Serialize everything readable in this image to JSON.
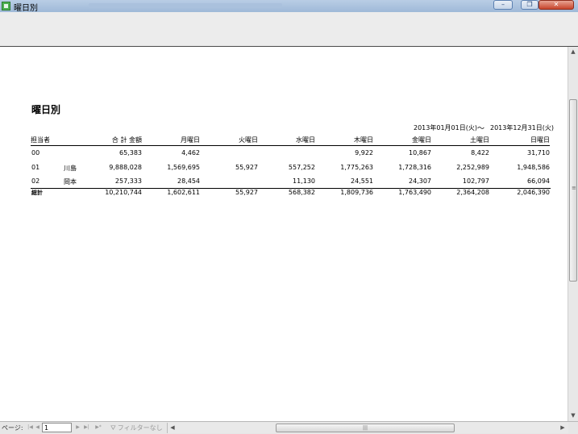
{
  "window": {
    "title": "曜日別",
    "minimize_glyph": "–",
    "restore_glyph": "❐",
    "close_glyph": "✕"
  },
  "report": {
    "title": "曜日別",
    "period_from": "2013年01月01日(火)",
    "period_sep": "～",
    "period_to": "2013年12月31日(火)",
    "headers": {
      "staff": "担当者",
      "total": "合 計 金額",
      "mon": "月曜日",
      "tue": "火曜日",
      "wed": "水曜日",
      "thu": "木曜日",
      "fri": "金曜日",
      "sat": "土曜日",
      "sun": "日曜日"
    },
    "rows": [
      {
        "code": "00",
        "name": "",
        "total": "65,383",
        "mon": "4,462",
        "tue": "",
        "wed": "",
        "thu": "9,922",
        "fri": "10,867",
        "sat": "8,422",
        "sun": "31,710"
      },
      {
        "code": "01",
        "name": "川島",
        "total": "9,888,028",
        "mon": "1,569,695",
        "tue": "55,927",
        "wed": "557,252",
        "thu": "1,775,263",
        "fri": "1,728,316",
        "sat": "2,252,989",
        "sun": "1,948,586"
      },
      {
        "code": "02",
        "name": "岡本",
        "total": "257,333",
        "mon": "28,454",
        "tue": "",
        "wed": "11,130",
        "thu": "24,551",
        "fri": "24,307",
        "sat": "102,797",
        "sun": "66,094"
      }
    ],
    "totals": {
      "label": "総計",
      "total": "10,210,744",
      "mon": "1,602,611",
      "tue": "55,927",
      "wed": "568,382",
      "thu": "1,809,736",
      "fri": "1,763,490",
      "sat": "2,364,208",
      "sun": "2,046,390"
    }
  },
  "statusbar": {
    "page_label": "ページ:",
    "page_value": "1",
    "filter_label": "フィルターなし",
    "filter_icon": "filter-icon",
    "nav_first": "|◀",
    "nav_prev": "◀",
    "nav_next": "▶",
    "nav_last": "▶|",
    "nav_new": "▶*"
  },
  "scrollbars": {
    "up": "▲",
    "down": "▼",
    "left": "◀",
    "right": "▶",
    "v_grip": "≡",
    "h_grip": "|||"
  }
}
